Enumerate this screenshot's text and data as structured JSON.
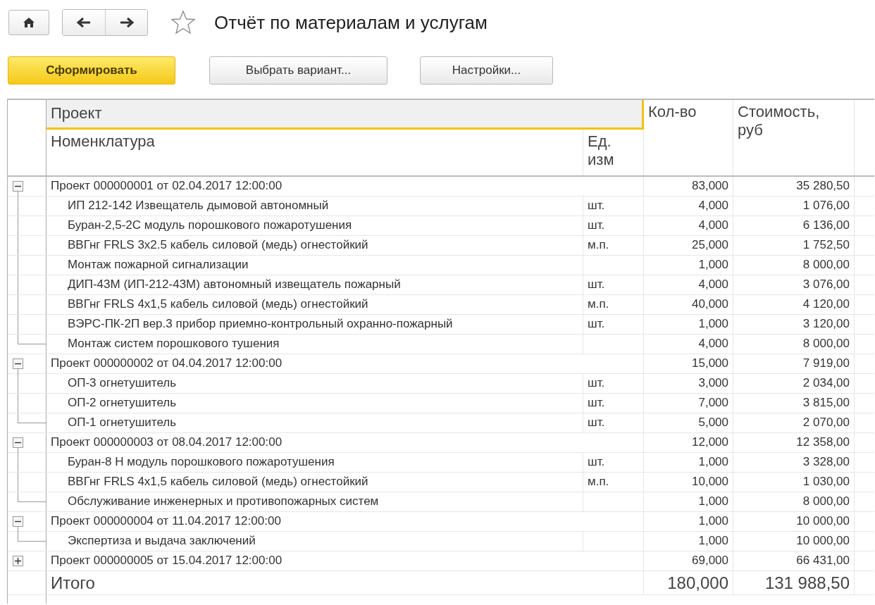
{
  "toolbar": {
    "title": "Отчёт по материалам и услугам",
    "favorite": false
  },
  "buttons": [
    {
      "label": "Сформировать",
      "kind": "primary"
    },
    {
      "label": "Выбрать вариант...",
      "kind": "default"
    },
    {
      "label": "Настройки...",
      "kind": "default"
    }
  ],
  "table": {
    "columns": [
      {
        "label": "Проект",
        "selected": true
      },
      {
        "label": "Номенклатура",
        "selected": false
      },
      {
        "label": "Ед. изм",
        "selected": false
      },
      {
        "label": "Кол-во",
        "selected": false
      },
      {
        "label": "Стоимость, руб",
        "selected": false
      }
    ],
    "groups": [
      {
        "label": "Проект 000000001 от 02.04.2017 12:00:00",
        "qty": "83,000",
        "cost": "35 280,50",
        "expanded": true,
        "items": [
          {
            "name": "ИП 212-142 Извещатель дымовой автономный",
            "unit": "шт.",
            "qty": "4,000",
            "cost": "1 076,00"
          },
          {
            "name": "Буран-2,5-2С модуль порошкового пожаротушения",
            "unit": "шт.",
            "qty": "4,000",
            "cost": "6 136,00"
          },
          {
            "name": "ВВГнг FRLS 3х2.5 кабель силовой (медь) огнестойкий",
            "unit": "м.п.",
            "qty": "25,000",
            "cost": "1 752,50"
          },
          {
            "name": "Монтаж пожарной сигнализации",
            "qty": "1,000",
            "cost": "8 000,00"
          },
          {
            "name": "ДИП-43М (ИП-212-43М) автономный извещатель пожарный",
            "unit": "шт.",
            "qty": "4,000",
            "cost": "3 076,00"
          },
          {
            "name": "ВВГнг FRLS 4х1,5 кабель силовой (медь) огнестойкий",
            "unit": "м.п.",
            "qty": "40,000",
            "cost": "4 120,00"
          },
          {
            "name": "ВЭРС-ПК-2П вер.3 прибор приемно-контрольный охранно-пожарный",
            "unit": "шт.",
            "qty": "1,000",
            "cost": "3 120,00"
          },
          {
            "name": "Монтаж систем порошкового тушения",
            "qty": "4,000",
            "cost": "8 000,00"
          }
        ]
      },
      {
        "label": "Проект 000000002 от 04.04.2017 12:00:00",
        "qty": "15,000",
        "cost": "7 919,00",
        "expanded": true,
        "items": [
          {
            "name": "ОП-3 огнетушитель",
            "unit": "шт.",
            "qty": "3,000",
            "cost": "2 034,00"
          },
          {
            "name": "ОП-2 огнетушитель",
            "unit": "шт.",
            "qty": "7,000",
            "cost": "3 815,00"
          },
          {
            "name": "ОП-1 огнетушитель",
            "unit": "шт.",
            "qty": "5,000",
            "cost": "2 070,00"
          }
        ]
      },
      {
        "label": "Проект 000000003 от 08.04.2017 12:00:00",
        "qty": "12,000",
        "cost": "12 358,00",
        "expanded": true,
        "items": [
          {
            "name": "Буран-8 Н модуль порошкового пожаротушения",
            "unit": "шт.",
            "qty": "1,000",
            "cost": "3 328,00"
          },
          {
            "name": "ВВГнг FRLS 4х1,5 кабель силовой (медь) огнестойкий",
            "unit": "м.п.",
            "qty": "10,000",
            "cost": "1 030,00"
          },
          {
            "name": "Обслуживание инженерных и противопожарных систем",
            "qty": "1,000",
            "cost": "8 000,00"
          }
        ]
      },
      {
        "label": "Проект 000000004 от 11.04.2017 12:00:00",
        "qty": "1,000",
        "cost": "10 000,00",
        "expanded": true,
        "items": [
          {
            "name": "Экспертиза и выдача заключений",
            "qty": "1,000",
            "cost": "10 000,00"
          }
        ]
      },
      {
        "label": "Проект 000000005 от 15.04.2017 12:00:00",
        "qty": "69,000",
        "cost": "66 431,00",
        "expanded": false
      }
    ],
    "totals": {
      "label": "Итого",
      "qty": "180,000",
      "cost": "131 988,50"
    }
  }
}
